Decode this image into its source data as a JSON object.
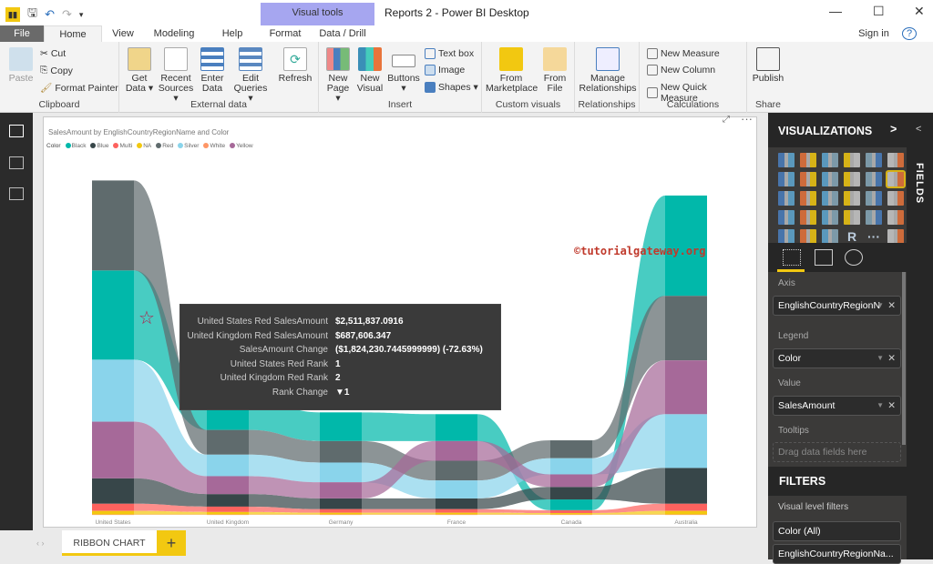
{
  "titlebar": {
    "title": "Reports 2 - Power BI Desktop",
    "context_tab": "Visual tools",
    "signin": "Sign in"
  },
  "tabs": [
    "File",
    "Home",
    "View",
    "Modeling",
    "Help",
    "Format",
    "Data / Drill"
  ],
  "ribbon": {
    "clipboard": {
      "paste": "Paste",
      "cut": "Cut",
      "copy": "Copy",
      "format_painter": "Format Painter",
      "label": "Clipboard"
    },
    "external": {
      "get_data": "Get Data ▾",
      "recent": "Recent Sources ▾",
      "enter": "Enter Data",
      "edit": "Edit Queries ▾",
      "refresh": "Refresh",
      "label": "External data"
    },
    "insert": {
      "new_page": "New Page ▾",
      "new_visual": "New Visual",
      "buttons": "Buttons ▾",
      "textbox": "Text box",
      "image": "Image",
      "shapes": "Shapes ▾",
      "label": "Insert"
    },
    "custom": {
      "marketplace": "From Marketplace",
      "file": "From File",
      "label": "Custom visuals"
    },
    "relationships": {
      "manage": "Manage Relationships",
      "label": "Relationships"
    },
    "calculations": {
      "measure": "New Measure",
      "column": "New Column",
      "quick": "New Quick Measure",
      "label": "Calculations"
    },
    "share": {
      "publish": "Publish",
      "label": "Share"
    }
  },
  "visual": {
    "title": "SalesAmount by EnglishCountryRegionName and Color",
    "legend_title": "Color",
    "watermark": "©tutorialgateway.org"
  },
  "chart_data": {
    "type": "ribbon",
    "title": "SalesAmount by EnglishCountryRegionName and Color",
    "categories": [
      "United States",
      "United Kingdom",
      "Germany",
      "France",
      "Canada",
      "Australia"
    ],
    "unit": "millions",
    "series": [
      {
        "name": "Black",
        "color": "#01B8AA",
        "values": [
          2.49,
          0.9,
          0.8,
          0.75,
          0.3,
          2.8
        ]
      },
      {
        "name": "Blue",
        "color": "#374649",
        "values": [
          0.71,
          0.35,
          0.3,
          0.3,
          0.35,
          1.0
        ]
      },
      {
        "name": "Multi",
        "color": "#FD625E",
        "values": [
          0.2,
          0.15,
          0.1,
          0.1,
          0.08,
          0.2
        ]
      },
      {
        "name": "NA",
        "color": "#F2C80F",
        "values": [
          0.1,
          0.07,
          0.05,
          0.05,
          0.04,
          0.1
        ]
      },
      {
        "name": "Red",
        "color": "#5F6B6D",
        "values": [
          2.51,
          0.69,
          0.6,
          0.55,
          0.5,
          1.8
        ]
      },
      {
        "name": "Silver",
        "color": "#8AD4EB",
        "values": [
          1.73,
          0.6,
          0.55,
          0.5,
          0.45,
          1.5
        ]
      },
      {
        "name": "White",
        "color": "#FE9666",
        "values": [
          0.01,
          0.01,
          0.01,
          0.01,
          0.01,
          0.01
        ]
      },
      {
        "name": "Yellow",
        "color": "#A66999",
        "values": [
          1.58,
          0.5,
          0.45,
          0.55,
          0.35,
          1.5
        ]
      }
    ]
  },
  "tooltip": [
    {
      "k": "United States Red SalesAmount",
      "v": "$2,511,837.0916"
    },
    {
      "k": "United Kingdom Red SalesAmount",
      "v": "$687,606.347"
    },
    {
      "k": "SalesAmount Change",
      "v": "($1,824,230.7445999999) (-72.63%)"
    },
    {
      "k": "United States Red Rank",
      "v": "1"
    },
    {
      "k": "United Kingdom Red Rank",
      "v": "2"
    },
    {
      "k": "Rank Change",
      "v": "▼1"
    }
  ],
  "pages": {
    "current": "RIBBON CHART",
    "add": "+"
  },
  "viz": {
    "header": "VISUALIZATIONS",
    "chevron": ">",
    "more": "···",
    "axis_label": "Axis",
    "axis_value": "EnglishCountryRegionN",
    "legend_label": "Legend",
    "legend_value": "Color",
    "value_label": "Value",
    "value_value": "SalesAmount",
    "tooltips_label": "Tooltips",
    "tooltips_placeholder": "Drag data fields here",
    "filters_header": "FILTERS",
    "visual_filters": "Visual level filters",
    "filter1": "Color (All)",
    "filter2": "EnglishCountryRegionNa..."
  },
  "fields": {
    "label": "FIELDS",
    "chevron": "<"
  }
}
